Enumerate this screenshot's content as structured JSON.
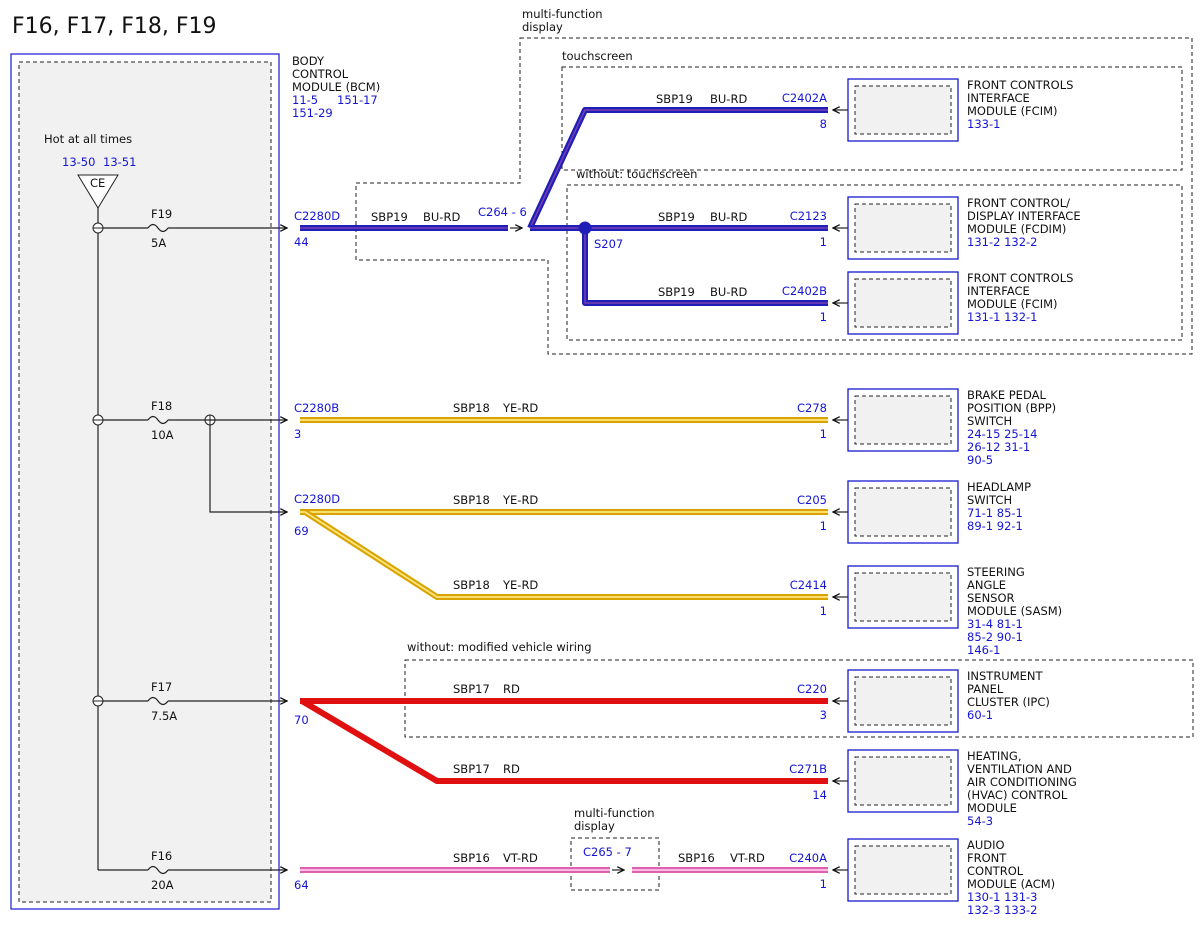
{
  "title": "F16, F17, F18, F19",
  "bcm": {
    "name_lines": [
      "BODY",
      "CONTROL",
      "MODULE (BCM)"
    ],
    "refs_line1_a": "11-5",
    "refs_line1_b": "151-17",
    "refs_line2": "151-29"
  },
  "power": {
    "label": "Hot at all times",
    "ref_a": "13-50",
    "ref_b": "13-51",
    "ce": "CE"
  },
  "fuses": [
    {
      "id": "F19",
      "rating": "5A"
    },
    {
      "id": "F18",
      "rating": "10A"
    },
    {
      "id": "F17",
      "rating": "7.5A"
    },
    {
      "id": "F16",
      "rating": "20A"
    }
  ],
  "groups": {
    "mfd_top": [
      "multi-function",
      "display"
    ],
    "touchscreen": "touchscreen",
    "without_touchscreen": "without: touchscreen",
    "without_modified": "without: modified vehicle wiring",
    "mfd_bottom": [
      "multi-function",
      "display"
    ]
  },
  "bcm_connectors": [
    {
      "name": "C2280D",
      "pin": "44"
    },
    {
      "name": "C2280B",
      "pin": "3"
    },
    {
      "name": "C2280D",
      "pin": "69"
    },
    {
      "name": "",
      "pin": "70"
    },
    {
      "name": "",
      "pin": "64"
    }
  ],
  "inline_connectors": {
    "c264": "C264  -  6",
    "c265": "C265  -  7",
    "splice": "S207"
  },
  "circuits": [
    {
      "circuit": "SBP19",
      "color": "BU-RD"
    },
    {
      "circuit": "SBP19",
      "color": "BU-RD"
    },
    {
      "circuit": "SBP19",
      "color": "BU-RD"
    },
    {
      "circuit": "SBP19",
      "color": "BU-RD"
    },
    {
      "circuit": "SBP18",
      "color": "YE-RD"
    },
    {
      "circuit": "SBP18",
      "color": "YE-RD"
    },
    {
      "circuit": "SBP18",
      "color": "YE-RD"
    },
    {
      "circuit": "SBP17",
      "color": "RD"
    },
    {
      "circuit": "SBP17",
      "color": "RD"
    },
    {
      "circuit": "SBP16",
      "color": "VT-RD"
    },
    {
      "circuit": "SBP16",
      "color": "VT-RD"
    }
  ],
  "modules": [
    {
      "connector": "C2402A",
      "pin": "8",
      "name": [
        "FRONT CONTROLS",
        "INTERFACE",
        "MODULE (FCIM)"
      ],
      "refs": [
        "133-1"
      ]
    },
    {
      "connector": "C2123",
      "pin": "1",
      "name": [
        "FRONT CONTROL/",
        "DISPLAY INTERFACE",
        "MODULE (FCDIM)"
      ],
      "refs": [
        "131-2  132-2"
      ]
    },
    {
      "connector": "C2402B",
      "pin": "1",
      "name": [
        "FRONT CONTROLS",
        "INTERFACE",
        "MODULE (FCIM)"
      ],
      "refs": [
        "131-1  132-1"
      ]
    },
    {
      "connector": "C278",
      "pin": "1",
      "name": [
        "BRAKE PEDAL",
        "POSITION (BPP)",
        "SWITCH"
      ],
      "refs": [
        "24-15  25-14",
        "26-12  31-1",
        "90-5"
      ]
    },
    {
      "connector": "C205",
      "pin": "1",
      "name": [
        "HEADLAMP",
        "SWITCH"
      ],
      "refs": [
        "71-1    85-1",
        "89-1    92-1"
      ]
    },
    {
      "connector": "C2414",
      "pin": "1",
      "name": [
        "STEERING",
        "ANGLE",
        "SENSOR",
        "MODULE (SASM)"
      ],
      "refs": [
        "31-4    81-1",
        "85-2    90-1",
        "146-1"
      ]
    },
    {
      "connector": "C220",
      "pin": "3",
      "name": [
        "INSTRUMENT",
        "PANEL",
        "CLUSTER (IPC)"
      ],
      "refs": [
        "60-1"
      ]
    },
    {
      "connector": "C271B",
      "pin": "14",
      "name": [
        "HEATING,",
        "VENTILATION AND",
        "AIR CONDITIONING",
        "(HVAC) CONTROL",
        "MODULE"
      ],
      "refs": [
        "54-3"
      ]
    },
    {
      "connector": "C240A",
      "pin": "1",
      "name": [
        "AUDIO",
        "FRONT",
        "CONTROL",
        "MODULE (ACM)"
      ],
      "refs": [
        "130-1  131-3",
        "132-3  133-2"
      ]
    }
  ],
  "colors": {
    "blue_wire": "#1f1fb8",
    "blue_inner": "#7a3fb0",
    "yellow_wire": "#d9a400",
    "yellow_inner": "#ffe680",
    "red_wire": "#e01010",
    "violet_wire": "#e060b0",
    "violet_inner": "#ffc8e8",
    "module_border": "#1a1ad0",
    "ref_text": "#1414d6"
  }
}
